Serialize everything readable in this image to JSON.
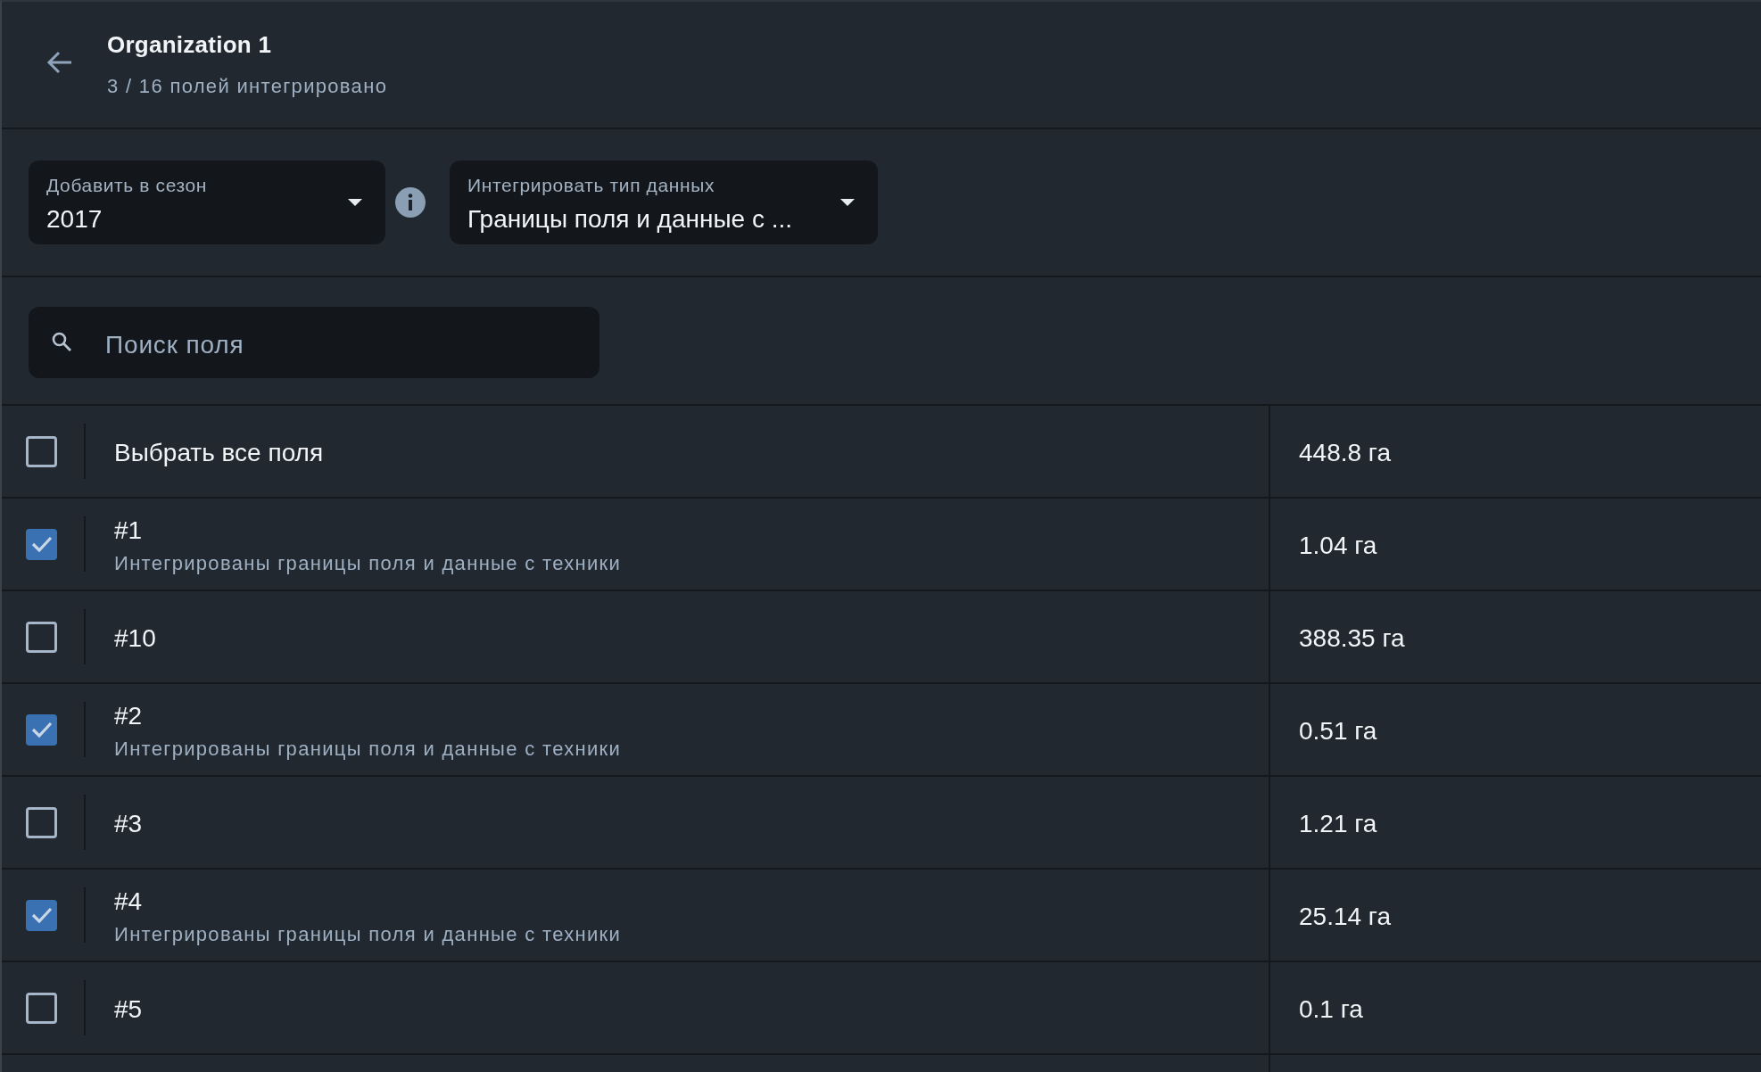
{
  "header": {
    "title": "Organization 1",
    "subtitle": "3 / 16 полей интегрировано"
  },
  "season_select": {
    "label": "Добавить в сезон",
    "value": "2017"
  },
  "data_type_select": {
    "label": "Интегрировать тип данных",
    "value": "Границы поля и данные с ..."
  },
  "search": {
    "placeholder": "Поиск поля"
  },
  "select_all": {
    "label": "Выбрать все поля",
    "checked": false,
    "area": "448.8 га"
  },
  "fields": [
    {
      "name": "#1",
      "status": "Интегрированы границы поля и данные с техники",
      "checked": true,
      "area": "1.04 га"
    },
    {
      "name": "#10",
      "checked": false,
      "area": "388.35 га"
    },
    {
      "name": "#2",
      "status": "Интегрированы границы поля и данные с техники",
      "checked": true,
      "area": "0.51 га"
    },
    {
      "name": "#3",
      "checked": false,
      "area": "1.21 га"
    },
    {
      "name": "#4",
      "status": "Интегрированы границы поля и данные с техники",
      "checked": true,
      "area": "25.14 га"
    },
    {
      "name": "#5",
      "checked": false,
      "area": "0.1 га"
    }
  ]
}
